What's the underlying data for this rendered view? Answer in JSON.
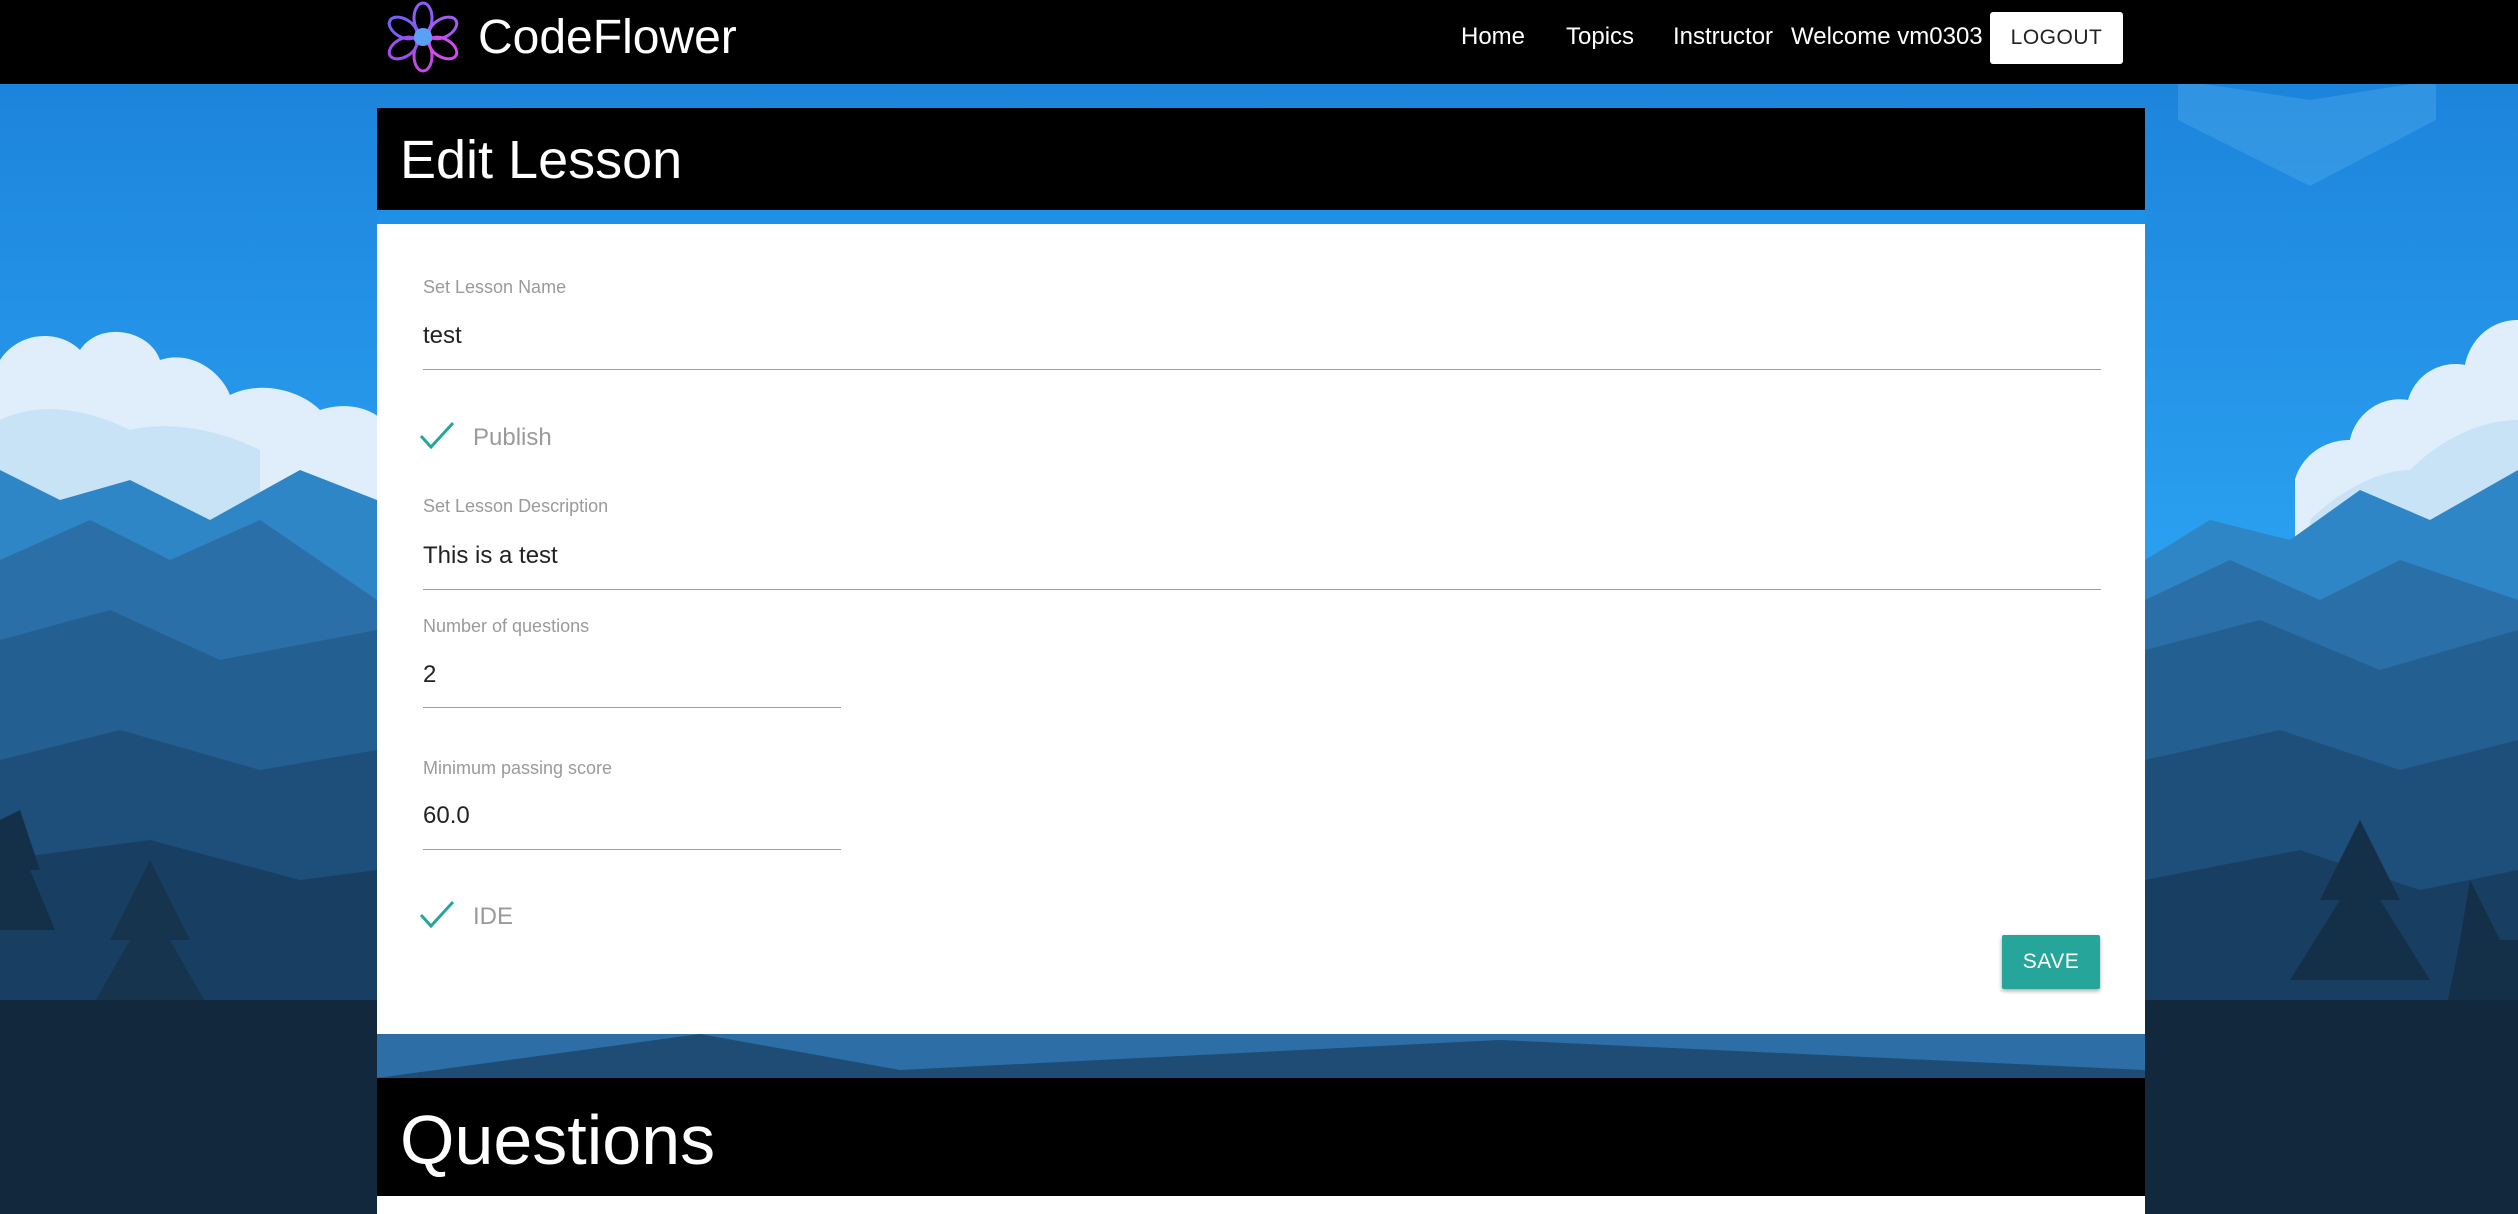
{
  "app": {
    "name": "CodeFlower"
  },
  "nav": {
    "links": [
      "Home",
      "Topics",
      "Instructor"
    ],
    "welcome": "Welcome vm0303",
    "logout_label": "LOGOUT"
  },
  "edit_lesson": {
    "title": "Edit Lesson",
    "lesson_name": {
      "label": "Set Lesson Name",
      "value": "test"
    },
    "publish": {
      "label": "Publish",
      "checked": true
    },
    "lesson_description": {
      "label": "Set Lesson Description",
      "value": "This is a test"
    },
    "num_questions": {
      "label": "Number of questions",
      "value": "2"
    },
    "min_passing_score": {
      "label": "Minimum passing score",
      "value": "60.0"
    },
    "ide": {
      "label": "IDE",
      "checked": true
    },
    "save_label": "SAVE"
  },
  "questions": {
    "title": "Questions"
  },
  "colors": {
    "accent_teal": "#26a69a",
    "navbar": "#000000",
    "sky_blue": "#1c80d6"
  }
}
